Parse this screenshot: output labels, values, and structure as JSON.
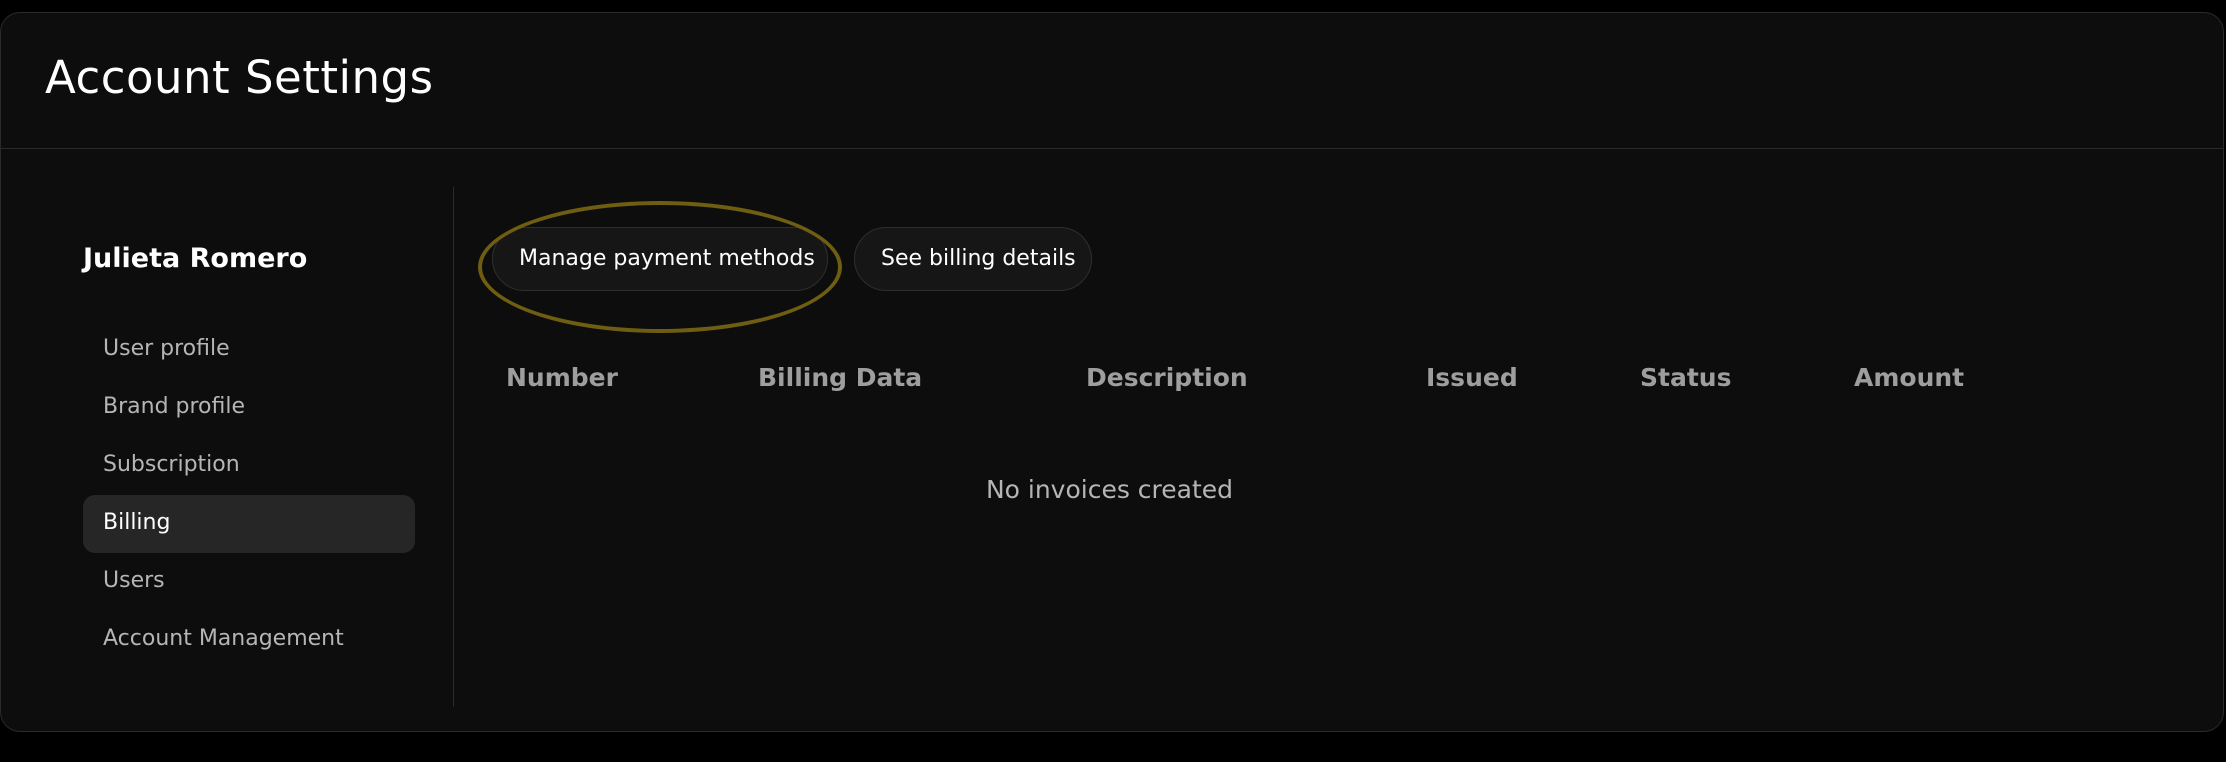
{
  "header": {
    "title": "Account Settings"
  },
  "sidebar": {
    "user_name": "Julieta Romero",
    "items": [
      {
        "label": "User profile",
        "active": false
      },
      {
        "label": "Brand profile",
        "active": false
      },
      {
        "label": "Subscription",
        "active": false
      },
      {
        "label": "Billing",
        "active": true
      },
      {
        "label": "Users",
        "active": false
      },
      {
        "label": "Account Management",
        "active": false
      }
    ]
  },
  "billing": {
    "actions": {
      "manage_payment_label": "Manage payment methods",
      "billing_details_label": "See billing details"
    },
    "table": {
      "columns": [
        "Number",
        "Billing Data",
        "Description",
        "Issued",
        "Status",
        "Amount"
      ],
      "empty_message": "No invoices created"
    }
  },
  "colors": {
    "background": "#000000",
    "panel": "#0d0d0d",
    "active_nav": "#262626",
    "highlight": "#6f5d12"
  }
}
